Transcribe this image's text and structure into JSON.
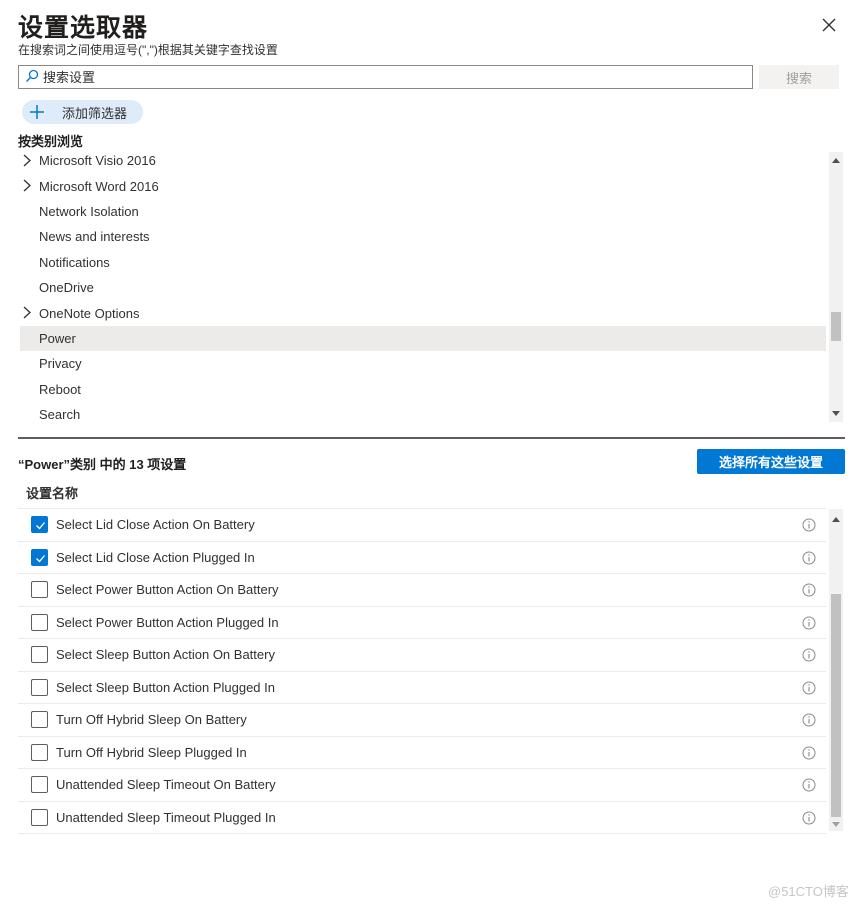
{
  "header": {
    "title": "设置选取器",
    "subtitle": "在搜索词之间使用逗号(\",\")根据其关键字查找设置",
    "close_icon": "close-icon"
  },
  "search": {
    "placeholder": "搜索设置",
    "value": "",
    "button_label": "搜索",
    "icon": "search-icon"
  },
  "filter": {
    "add_label": "添加筛选器",
    "icon": "plus-icon"
  },
  "browse": {
    "label": "按类别浏览",
    "categories": [
      {
        "label": "Microsoft Visio 2016",
        "expandable": true,
        "selected": false
      },
      {
        "label": "Microsoft Word 2016",
        "expandable": true,
        "selected": false
      },
      {
        "label": "Network Isolation",
        "expandable": false,
        "selected": false
      },
      {
        "label": "News and interests",
        "expandable": false,
        "selected": false
      },
      {
        "label": "Notifications",
        "expandable": false,
        "selected": false
      },
      {
        "label": "OneDrive",
        "expandable": false,
        "selected": false
      },
      {
        "label": "OneNote Options",
        "expandable": true,
        "selected": false
      },
      {
        "label": "Power",
        "expandable": false,
        "selected": true
      },
      {
        "label": "Privacy",
        "expandable": false,
        "selected": false
      },
      {
        "label": "Reboot",
        "expandable": false,
        "selected": false
      },
      {
        "label": "Search",
        "expandable": false,
        "selected": false
      }
    ]
  },
  "results": {
    "count_label": "“Power”类别 中的 13 项设置",
    "select_all_label": "选择所有这些设置",
    "column_header": "设置名称",
    "settings": [
      {
        "label": "Select Lid Close Action On Battery",
        "checked": true
      },
      {
        "label": "Select Lid Close Action Plugged In",
        "checked": true
      },
      {
        "label": "Select Power Button Action On Battery",
        "checked": false
      },
      {
        "label": "Select Power Button Action Plugged In",
        "checked": false
      },
      {
        "label": "Select Sleep Button Action On Battery",
        "checked": false
      },
      {
        "label": "Select Sleep Button Action Plugged In",
        "checked": false
      },
      {
        "label": "Turn Off Hybrid Sleep On Battery",
        "checked": false
      },
      {
        "label": "Turn Off Hybrid Sleep Plugged In",
        "checked": false
      },
      {
        "label": "Unattended Sleep Timeout On Battery",
        "checked": false
      },
      {
        "label": "Unattended Sleep Timeout Plugged In",
        "checked": false
      }
    ]
  },
  "colors": {
    "accent": "#0078d4",
    "filter_pill": "#deecf9",
    "selected_row": "#edebe9"
  },
  "watermark": "@51CTO博客"
}
